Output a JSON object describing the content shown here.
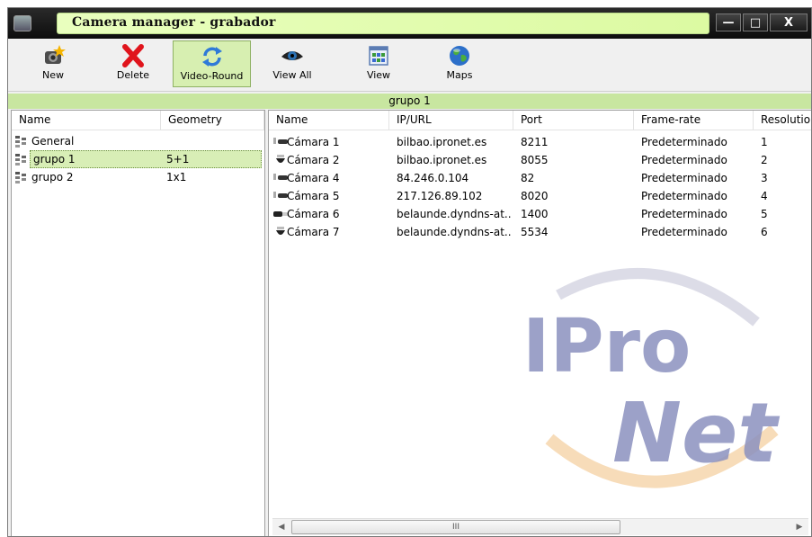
{
  "window": {
    "title": "Camera manager - grabador",
    "buttons": {
      "minimize": "—",
      "maximize": "□",
      "close": "X"
    }
  },
  "toolbar": {
    "new_label": "New",
    "delete_label": "Delete",
    "video_round_label": "Video-Round",
    "view_all_label": "View All",
    "view_label": "View",
    "maps_label": "Maps"
  },
  "group_header": "grupo 1",
  "groups_panel": {
    "columns": {
      "name": "Name",
      "geometry": "Geometry"
    },
    "rows": [
      {
        "name": "General",
        "geometry": ""
      },
      {
        "name": "grupo 1",
        "geometry": "5+1"
      },
      {
        "name": "grupo 2",
        "geometry": "1x1"
      }
    ],
    "selected": "grupo 1"
  },
  "cameras_panel": {
    "columns": {
      "name": "Name",
      "ip": "IP/URL",
      "port": "Port",
      "framerate": "Frame-rate",
      "resolution": "Resolution"
    },
    "rows": [
      {
        "name": "Cámara 1",
        "ip": "bilbao.ipronet.es",
        "port": "8211",
        "framerate": "Predeterminado",
        "resolution": "1",
        "icon": "bullet-camera-icon"
      },
      {
        "name": "Cámara 2",
        "ip": "bilbao.ipronet.es",
        "port": "8055",
        "framerate": "Predeterminado",
        "resolution": "2",
        "icon": "dome-camera-icon"
      },
      {
        "name": "Cámara 4",
        "ip": "84.246.0.104",
        "port": "82",
        "framerate": "Predeterminado",
        "resolution": "3",
        "icon": "bullet-camera-icon"
      },
      {
        "name": "Cámara 5",
        "ip": "217.126.89.102",
        "port": "8020",
        "framerate": "Predeterminado",
        "resolution": "4",
        "icon": "bullet-camera-icon"
      },
      {
        "name": "Cámara 6",
        "ip": "belaunde.dyndns-at...",
        "port": "1400",
        "framerate": "Predeterminado",
        "resolution": "5",
        "icon": "box-camera-icon"
      },
      {
        "name": "Cámara 7",
        "ip": "belaunde.dyndns-at...",
        "port": "5534",
        "framerate": "Predeterminado",
        "resolution": "6",
        "icon": "dome-camera-icon"
      }
    ]
  },
  "scrollbar": {
    "thumb_grip": "III",
    "left_arrow": "◀",
    "right_arrow": "▶"
  },
  "watermark": {
    "text_top": "IPro",
    "text_bottom": "Net"
  },
  "colors": {
    "title_bg": "#e9ffbe",
    "header_bg": "#c8e6a0",
    "selected_bg": "#d8eeb6",
    "watermark_blue": "#8b91bf",
    "watermark_orange": "#f6d6ad"
  }
}
